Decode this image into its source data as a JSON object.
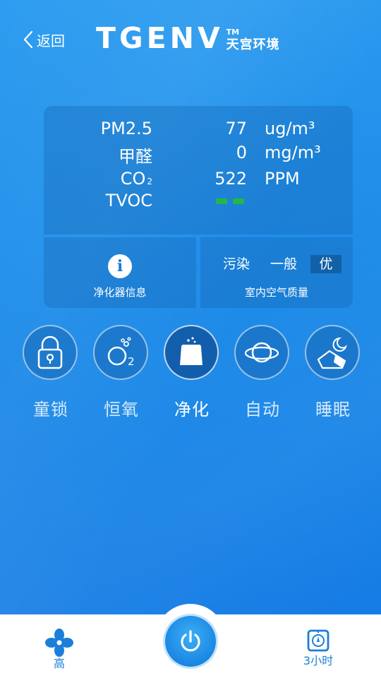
{
  "header": {
    "back_label": "返回",
    "logo_text": "TGENV",
    "logo_tm": "TM",
    "logo_cn": "天宫环境"
  },
  "readings": [
    {
      "name": "PM2.5",
      "value": "77",
      "unit": "ug/m³"
    },
    {
      "name": "甲醛",
      "value": "0",
      "unit": "mg/m³"
    },
    {
      "name": "CO",
      "name_sub": "2",
      "value": "522",
      "unit": "PPM"
    },
    {
      "name": "TVOC",
      "value": "",
      "unit": ""
    }
  ],
  "tvoc_indicator_color": "#23b74a",
  "purifier_info": {
    "icon_glyph": "i",
    "label": "净化器信息"
  },
  "air_quality": {
    "levels": [
      "污染",
      "一般",
      "优"
    ],
    "selected": "优",
    "label": "室内空气质量"
  },
  "modes": [
    {
      "label": "童锁",
      "icon": "lock-icon",
      "active": false
    },
    {
      "label": "恒氧",
      "icon": "oxygen-icon",
      "active": false
    },
    {
      "label": "净化",
      "icon": "purify-icon",
      "active": true
    },
    {
      "label": "自动",
      "icon": "planet-icon",
      "active": false
    },
    {
      "label": "睡眠",
      "icon": "moon-icon",
      "active": false
    }
  ],
  "bottom_bar": {
    "fan_label": "高",
    "timer_label": "3小时",
    "power_icon": "power-icon"
  },
  "colors": {
    "accent": "#1b7fd9",
    "background": "#1a8ae8"
  }
}
